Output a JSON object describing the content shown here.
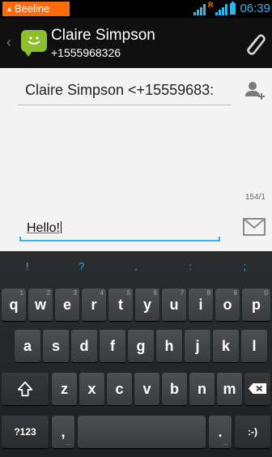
{
  "status_bar": {
    "carrier": "Beeline",
    "roaming_flag": "R",
    "time": "06:39",
    "accent_color": "#33b5e5",
    "carrier_color": "#ff6a0a"
  },
  "action_bar": {
    "contact_name": "Claire Simpson",
    "contact_number": "+1555968326",
    "icons": [
      "back-chevron-icon",
      "messaging-app-icon",
      "attach-icon"
    ]
  },
  "compose": {
    "recipient": "Claire Simpson <+15559683:",
    "char_counter": "154/1",
    "message": "Hello!",
    "icons": [
      "add-contact-icon",
      "send-icon"
    ]
  },
  "keyboard": {
    "suggestions": [
      "!",
      "?",
      ",",
      ":",
      ";"
    ],
    "row1": [
      {
        "label": "q",
        "hint": "1"
      },
      {
        "label": "w",
        "hint": "2"
      },
      {
        "label": "e",
        "hint": "3"
      },
      {
        "label": "r",
        "hint": "4"
      },
      {
        "label": "t",
        "hint": "5"
      },
      {
        "label": "y",
        "hint": "6"
      },
      {
        "label": "u",
        "hint": "7"
      },
      {
        "label": "i",
        "hint": "8"
      },
      {
        "label": "o",
        "hint": "9"
      },
      {
        "label": "p",
        "hint": "0"
      }
    ],
    "row2": [
      "a",
      "s",
      "d",
      "f",
      "g",
      "h",
      "j",
      "k",
      "l"
    ],
    "row3": [
      "z",
      "x",
      "c",
      "v",
      "b",
      "n",
      "m"
    ],
    "symbols_key": "?123",
    "comma_key": ",",
    "period_key": ".",
    "smiley_key": ":-)"
  }
}
